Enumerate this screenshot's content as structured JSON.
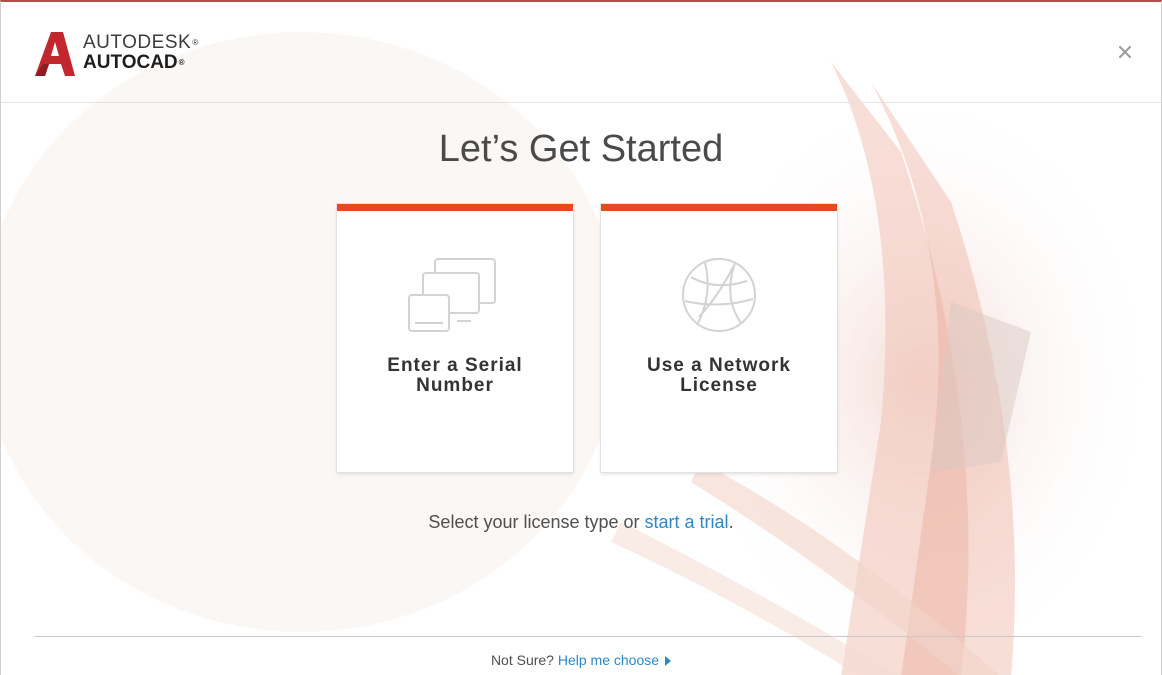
{
  "header": {
    "brand_top": "AUTODESK",
    "brand_bottom": "AUTOCAD",
    "close_icon": "close-icon",
    "logo_icon": "autocad-a-icon"
  },
  "title": "Let’s Get Started",
  "cards": [
    {
      "id": "serial",
      "line1": "Enter a Serial",
      "line2": "Number",
      "icon": "devices-icon"
    },
    {
      "id": "network",
      "line1": "Use a Network",
      "line2": "License",
      "icon": "network-globe-icon"
    }
  ],
  "prompt": {
    "text": "Select your license type or ",
    "link": "start a trial",
    "suffix": "."
  },
  "footer": {
    "text": "Not Sure? ",
    "link": "Help me choose"
  },
  "colors": {
    "accent": "#e24b1e",
    "link": "#2b8ac6",
    "logo_red": "#c1272d"
  }
}
